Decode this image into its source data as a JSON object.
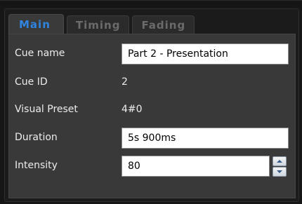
{
  "tabs": [
    {
      "label": "Main",
      "active": true
    },
    {
      "label": "Timing",
      "active": false
    },
    {
      "label": "Fading",
      "active": false
    }
  ],
  "form": {
    "cue_name": {
      "label": "Cue name",
      "value": "Part 2 - Presentation"
    },
    "cue_id": {
      "label": "Cue ID",
      "value": "2"
    },
    "visual_preset": {
      "label": "Visual Preset",
      "value": "4#0"
    },
    "duration": {
      "label": "Duration",
      "value": "5s 900ms"
    },
    "intensity": {
      "label": "Intensity",
      "value": "80"
    }
  },
  "icons": {
    "spin_up": "up-arrow-icon",
    "spin_down": "down-arrow-icon"
  },
  "colors": {
    "active_tab_text": "#2f84e0",
    "inactive_tab_text": "#6b6b6b",
    "panel_bg": "#393939",
    "window_bg": "#161616"
  }
}
